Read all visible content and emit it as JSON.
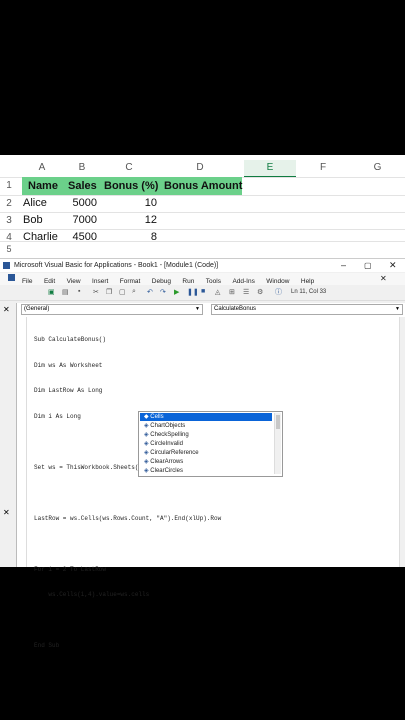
{
  "excel": {
    "columns": [
      "A",
      "B",
      "C",
      "D",
      "E",
      "F",
      "G"
    ],
    "rows": [
      "1",
      "2",
      "3",
      "4",
      "5"
    ],
    "headers": [
      "Name",
      "Sales",
      "Bonus (%)",
      "Bonus Amount"
    ],
    "data": [
      [
        "Alice",
        "5000",
        "10"
      ],
      [
        "Bob",
        "7000",
        "12"
      ],
      [
        "Charlie",
        "4500",
        "8"
      ]
    ],
    "colors": {
      "header_fill": "#6bd08a",
      "accent": "#107c41"
    }
  },
  "vba": {
    "title": "Microsoft Visual Basic for Applications - Book1 - [Module1 (Code)]",
    "menu": [
      "File",
      "Edit",
      "View",
      "Insert",
      "Format",
      "Debug",
      "Run",
      "Tools",
      "Add-Ins",
      "Window",
      "Help"
    ],
    "status": "Ln 11, Col 33",
    "object_dropdown": "(General)",
    "proc_dropdown": "CalculateBonus",
    "code": [
      "Sub CalculateBonus()",
      "Dim ws As Worksheet",
      "Dim LastRow As Long",
      "Dim i As Long",
      "",
      "Set ws = ThisWorkbook.Sheets(\"Sheet1\")",
      "",
      "LastRow = ws.Cells(ws.Rows.Count, \"A\").End(xlUp).Row",
      "",
      "For i = 2 To LastRow",
      "    ws.Cells(i,4).value=ws.cells",
      "",
      "End Sub"
    ],
    "autocomplete": [
      "Cells",
      "ChartObjects",
      "CheckSpelling",
      "CircleInvalid",
      "CircularReference",
      "ClearArrows",
      "ClearCircles"
    ],
    "autocomplete_selected": 0
  }
}
